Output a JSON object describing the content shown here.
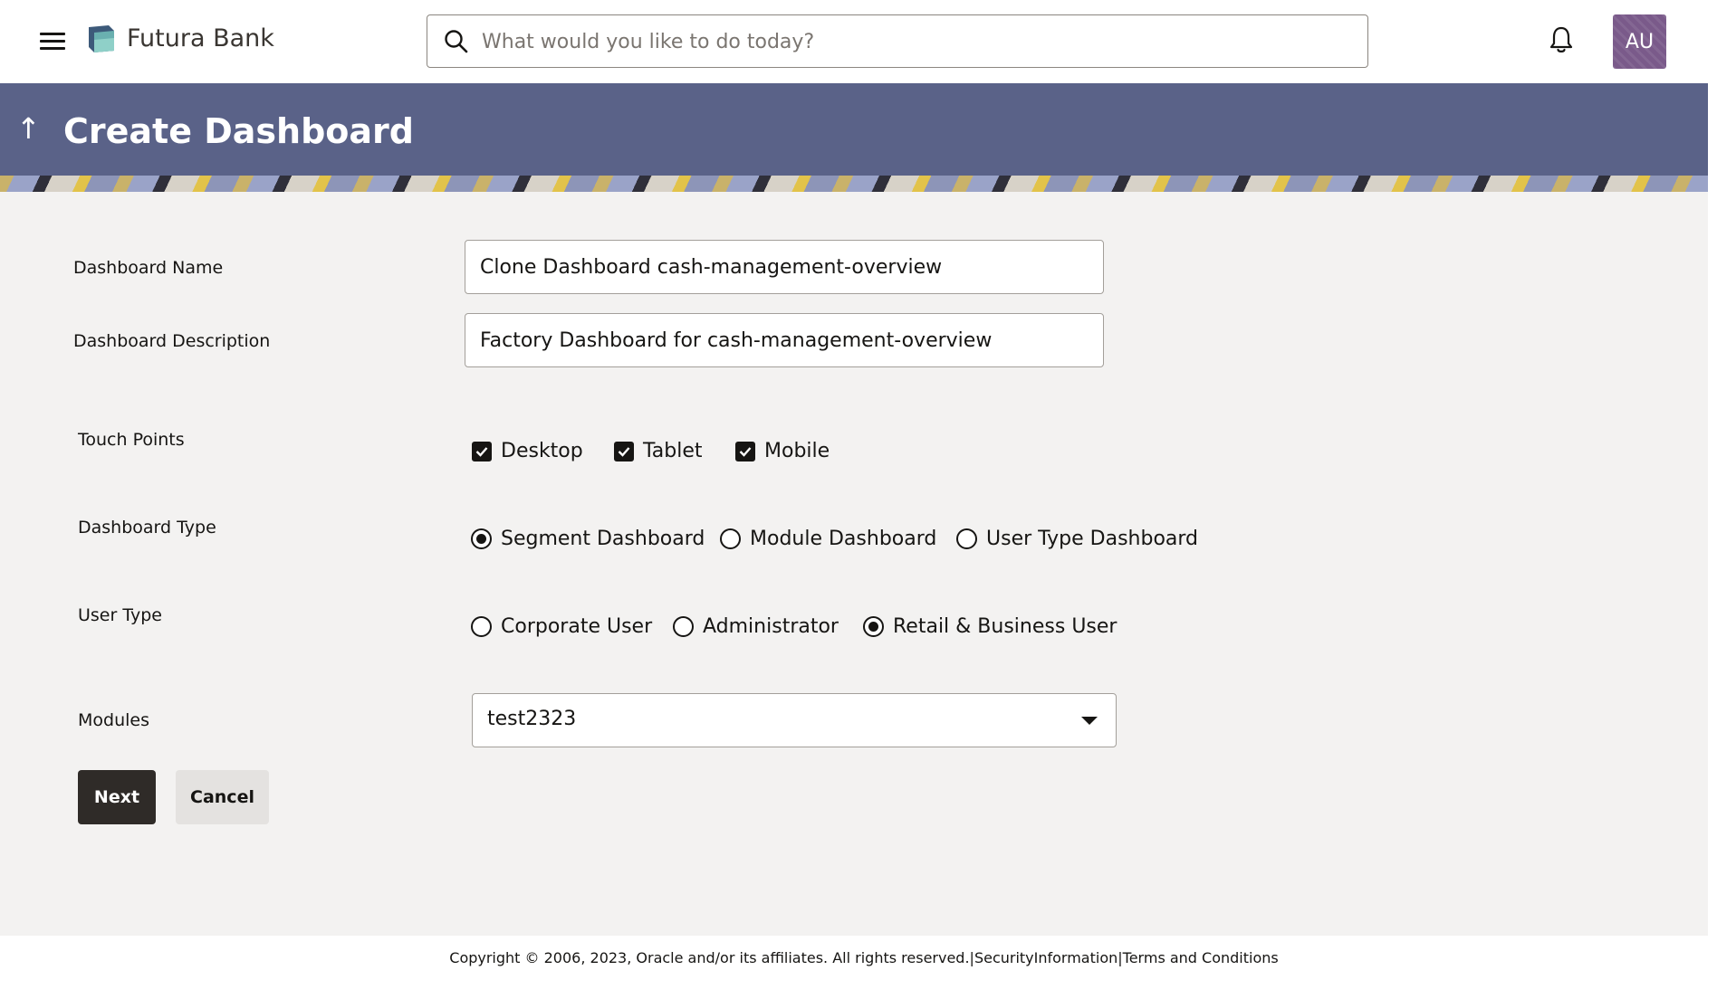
{
  "header": {
    "brand": "Futura Bank",
    "search_placeholder": "What would you like to do today?",
    "avatar_initials": "AU"
  },
  "banner": {
    "title": "Create Dashboard"
  },
  "form": {
    "dashboard_name_label": "Dashboard Name",
    "dashboard_name_value": "Clone Dashboard cash-management-overview",
    "dashboard_description_label": "Dashboard Description",
    "dashboard_description_value": "Factory Dashboard for cash-management-overview",
    "touch_points_label": "Touch Points",
    "touch_points": [
      {
        "label": "Desktop",
        "checked": true
      },
      {
        "label": "Tablet",
        "checked": true
      },
      {
        "label": "Mobile",
        "checked": true
      }
    ],
    "dashboard_type_label": "Dashboard Type",
    "dashboard_types": [
      {
        "label": "Segment Dashboard",
        "selected": true
      },
      {
        "label": "Module Dashboard",
        "selected": false
      },
      {
        "label": "User Type Dashboard",
        "selected": false
      }
    ],
    "user_type_label": "User Type",
    "user_types": [
      {
        "label": "Corporate User",
        "selected": false
      },
      {
        "label": "Administrator",
        "selected": false
      },
      {
        "label": "Retail & Business User",
        "selected": true
      }
    ],
    "modules_label": "Modules",
    "modules_value": "test2323"
  },
  "actions": {
    "next_label": "Next",
    "cancel_label": "Cancel"
  },
  "footer": {
    "copyright": "Copyright © 2006, 2023, Oracle and/or its affiliates. All rights reserved.|",
    "security_link": "SecurityInformation",
    "separator": "|",
    "terms_link": "Terms and Conditions"
  }
}
